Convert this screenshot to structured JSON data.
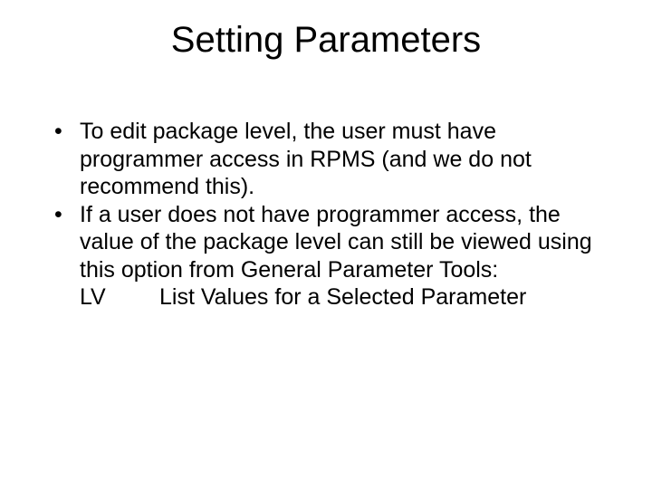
{
  "title": "Setting Parameters",
  "bullets": [
    "To edit package level, the user must have programmer access in RPMS (and we do not recommend this).",
    "If a user does not have programmer access, the value of the package level can still be viewed using this option from General Parameter Tools:"
  ],
  "option": {
    "code": "LV",
    "label": "List Values for a Selected Parameter"
  }
}
